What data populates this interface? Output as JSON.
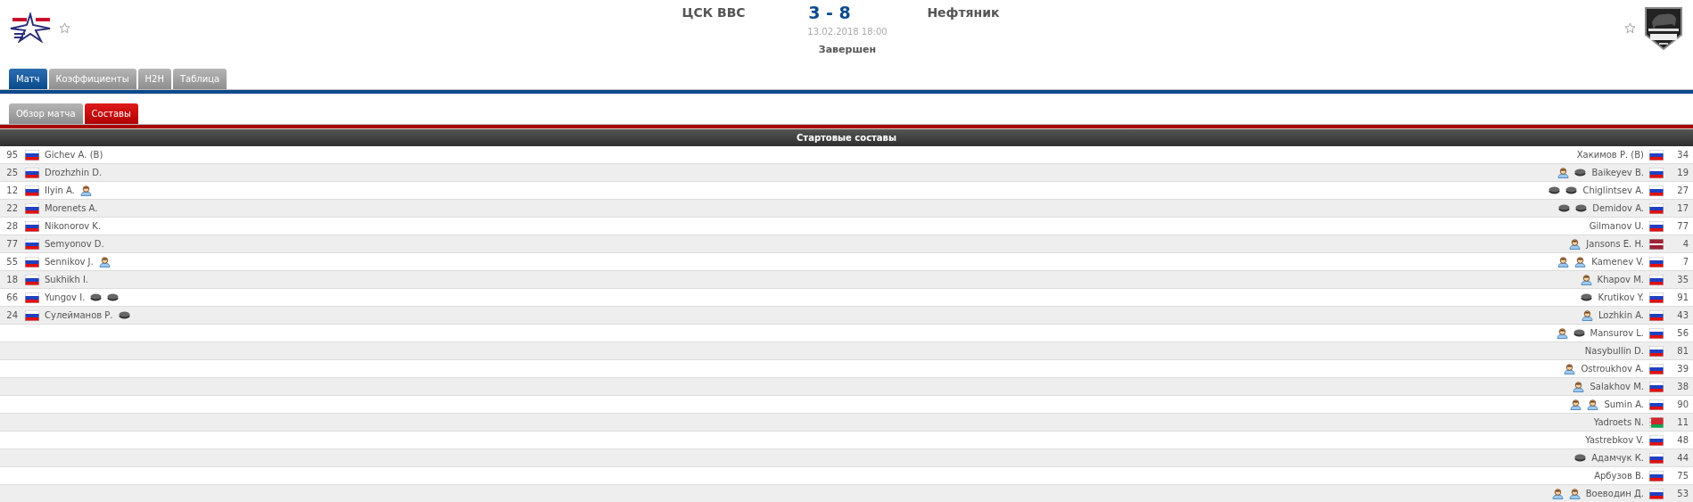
{
  "match": {
    "home_team": "ЦСК ВВС",
    "score": "3 - 8",
    "away_team": "Нефтяник",
    "datetime": "13.02.2018 18:00",
    "status": "Завершен",
    "home_favorite": false,
    "away_favorite": false
  },
  "tabs": [
    {
      "label": "Матч",
      "selected": true
    },
    {
      "label": "Коэффициенты",
      "selected": false
    },
    {
      "label": "H2H",
      "selected": false
    },
    {
      "label": "Таблица",
      "selected": false
    }
  ],
  "subtabs": [
    {
      "label": "Обзор матча",
      "selected": false
    },
    {
      "label": "Составы",
      "selected": true
    }
  ],
  "lineups": {
    "title": "Стартовые составы",
    "home": [
      {
        "number": "95",
        "flag": {
          "kind": "ru"
        },
        "name": "Gichev A. (B)"
      },
      {
        "number": "25",
        "flag": {
          "kind": "ru"
        },
        "name": "Drozhzhin D."
      },
      {
        "number": "12",
        "flag": {
          "kind": "ru"
        },
        "name": "Ilyin A.",
        "events": [
          {
            "kind": "assist"
          }
        ]
      },
      {
        "number": "22",
        "flag": {
          "kind": "ru"
        },
        "name": "Morenets A."
      },
      {
        "number": "28",
        "flag": {
          "kind": "ru"
        },
        "name": "Nikonorov K."
      },
      {
        "number": "77",
        "flag": {
          "kind": "ru"
        },
        "name": "Semyonov D."
      },
      {
        "number": "55",
        "flag": {
          "kind": "ru"
        },
        "name": "Sennikov J.",
        "events": [
          {
            "kind": "assist"
          }
        ]
      },
      {
        "number": "18",
        "flag": {
          "kind": "ru"
        },
        "name": "Sukhikh I."
      },
      {
        "number": "66",
        "flag": {
          "kind": "ru"
        },
        "name": "Yungov I.",
        "events": [
          {
            "kind": "goal"
          },
          {
            "kind": "goal"
          }
        ]
      },
      {
        "number": "24",
        "flag": {
          "kind": "ru"
        },
        "name": "Сулейманов Р.",
        "events": [
          {
            "kind": "goal"
          }
        ]
      }
    ],
    "away": [
      {
        "number": "34",
        "flag": {
          "kind": "ru"
        },
        "name": "Хакимов Р. (B)"
      },
      {
        "number": "19",
        "flag": {
          "kind": "ru"
        },
        "name": "Baikeyev B.",
        "events": [
          {
            "kind": "assist"
          },
          {
            "kind": "goal"
          }
        ]
      },
      {
        "number": "27",
        "flag": {
          "kind": "ru"
        },
        "name": "Chiglintsev A.",
        "events": [
          {
            "kind": "goal"
          },
          {
            "kind": "goal"
          }
        ]
      },
      {
        "number": "17",
        "flag": {
          "kind": "ru"
        },
        "name": "Demidov A.",
        "events": [
          {
            "kind": "goal"
          },
          {
            "kind": "goal"
          }
        ]
      },
      {
        "number": "77",
        "flag": {
          "kind": "ru"
        },
        "name": "Gilmanov U."
      },
      {
        "number": "4",
        "flag": {
          "kind": "lv"
        },
        "name": "Jansons E. H.",
        "events": [
          {
            "kind": "assist"
          }
        ]
      },
      {
        "number": "7",
        "flag": {
          "kind": "ru"
        },
        "name": "Kamenev V.",
        "events": [
          {
            "kind": "assist"
          },
          {
            "kind": "assist"
          }
        ]
      },
      {
        "number": "35",
        "flag": {
          "kind": "ru"
        },
        "name": "Khapov M.",
        "events": [
          {
            "kind": "assist"
          }
        ]
      },
      {
        "number": "91",
        "flag": {
          "kind": "ru"
        },
        "name": "Krutikov Y.",
        "events": [
          {
            "kind": "goal"
          }
        ]
      },
      {
        "number": "43",
        "flag": {
          "kind": "ru"
        },
        "name": "Lozhkin A.",
        "events": [
          {
            "kind": "assist"
          }
        ]
      },
      {
        "number": "56",
        "flag": {
          "kind": "ru"
        },
        "name": "Mansurov L.",
        "events": [
          {
            "kind": "assist"
          },
          {
            "kind": "goal"
          }
        ]
      },
      {
        "number": "81",
        "flag": {
          "kind": "ru"
        },
        "name": "Nasybullin D."
      },
      {
        "number": "39",
        "flag": {
          "kind": "ru"
        },
        "name": "Ostroukhov A.",
        "events": [
          {
            "kind": "assist"
          }
        ]
      },
      {
        "number": "38",
        "flag": {
          "kind": "ru"
        },
        "name": "Salakhov M.",
        "events": [
          {
            "kind": "assist"
          }
        ]
      },
      {
        "number": "90",
        "flag": {
          "kind": "ru"
        },
        "name": "Sumin A.",
        "events": [
          {
            "kind": "assist"
          },
          {
            "kind": "assist"
          }
        ]
      },
      {
        "number": "11",
        "flag": {
          "kind": "by"
        },
        "name": "Yadroets N."
      },
      {
        "number": "48",
        "flag": {
          "kind": "ru"
        },
        "name": "Yastrebkov V."
      },
      {
        "number": "44",
        "flag": {
          "kind": "ru"
        },
        "name": "Адамчук К.",
        "events": [
          {
            "kind": "goal"
          }
        ]
      },
      {
        "number": "75",
        "flag": {
          "kind": "ru"
        },
        "name": "Арбузов В."
      },
      {
        "number": "53",
        "flag": {
          "kind": "ru"
        },
        "name": "Воеводин Д.",
        "events": [
          {
            "kind": "assist"
          },
          {
            "kind": "assist"
          }
        ]
      }
    ]
  }
}
